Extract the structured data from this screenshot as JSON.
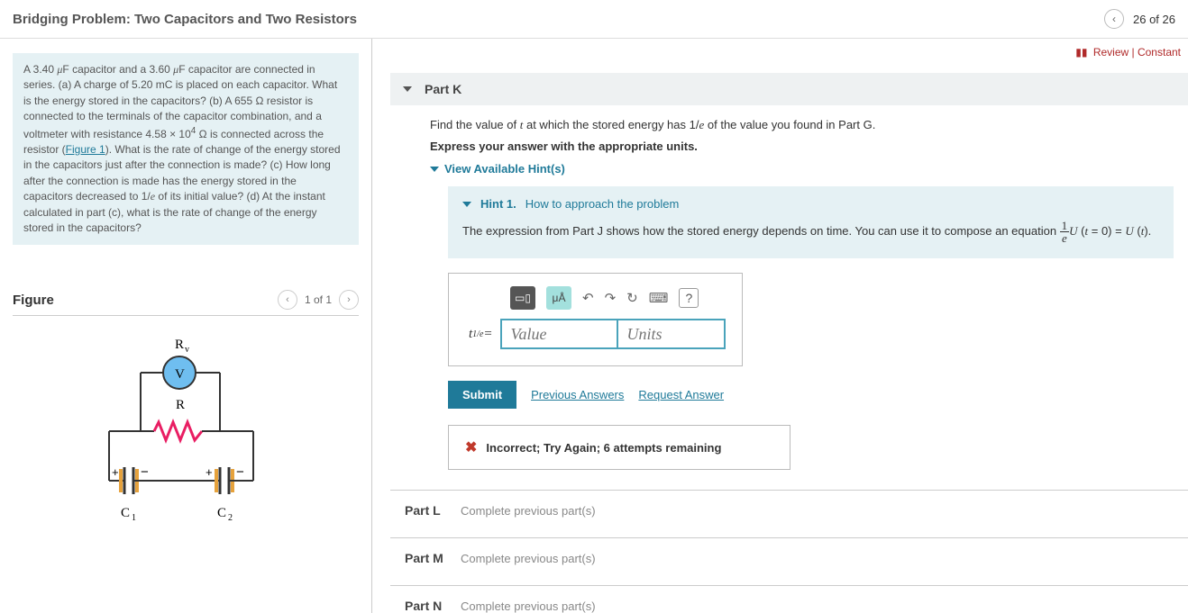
{
  "header": {
    "title": "Bridging Problem: Two Capacitors and Two Resistors",
    "counter": "26 of 26"
  },
  "review": {
    "review_label": "Review",
    "constants_label": "Constant"
  },
  "problem_html": "A 3.40 <span class='mvar'>μ</span>F capacitor and a 3.60 <span class='mvar'>μ</span>F capacitor are connected in series. (a) A charge of 5.20 mC is placed on each capacitor. What is the energy stored in the capacitors? (b) A 655 Ω resistor is connected to the terminals of the capacitor combination, and a voltmeter with resistance 4.58 × 10<sup>4</sup> Ω is connected across the resistor (<a href='#' style='color:#1f7a99'>Figure 1</a>). What is the rate of change of the energy stored in the capacitors just after the connection is made? (c) How long after the connection is made has the energy stored in the capacitors decreased to 1/<span class='mvar'>e</span> of its initial value? (d) At the instant calculated in part (c), what is the rate of change of the energy stored in the capacitors?",
  "figure": {
    "title": "Figure",
    "counter": "1 of 1"
  },
  "partK": {
    "label": "Part K",
    "line1_prefix": "Find the value of ",
    "line1_mid": " at which the stored energy has ",
    "line1_suffix": " of the value you found in Part G.",
    "line2": "Express your answer with the appropriate units.",
    "hints_link": "View Available Hint(s)",
    "hint1_label": "Hint 1.",
    "hint1_title": "How to approach the problem",
    "hint1_text_prefix": "The expression from Part J shows how the stored energy depends on time. You can use it to compose an equation ",
    "var_label_html": "<span class='mvar'>t</span><sub>1/<span class='mvar'>e</span></sub> =",
    "value_placeholder": "Value",
    "units_placeholder": "Units",
    "submit": "Submit",
    "prev_answers": "Previous Answers",
    "request_answer": "Request Answer",
    "feedback": "Incorrect; Try Again; 6 attempts remaining"
  },
  "locked": [
    {
      "label": "Part L",
      "msg": "Complete previous part(s)"
    },
    {
      "label": "Part M",
      "msg": "Complete previous part(s)"
    },
    {
      "label": "Part N",
      "msg": "Complete previous part(s)"
    }
  ]
}
